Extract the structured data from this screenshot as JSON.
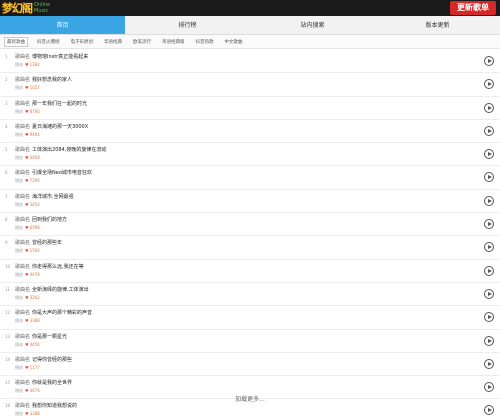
{
  "header": {
    "logo_text": "梦幻阁",
    "logo_sub1": "Online",
    "logo_sub2": "Music",
    "update_label": "更新歌单"
  },
  "nav": {
    "items": [
      "首页",
      "排行榜",
      "站内搜索",
      "版本更新"
    ]
  },
  "subnav": {
    "items": [
      "最新歌曲",
      "抖音火爆榜",
      "电子乐原创",
      "华语经典",
      "欧美流行",
      "英语经典版",
      "抖音热歌",
      "中文歌曲"
    ]
  },
  "list": {
    "prefix": "歌曲名",
    "meta_label": "播放",
    "items": [
      {
        "rank": "1",
        "title": "博物馆Instr真正能看起来",
        "count": "1284"
      },
      {
        "rank": "2",
        "title": "我好想念我的家人",
        "count": "1027"
      },
      {
        "rank": "3",
        "title": "那一年我们在一起的时光",
        "count": "8766"
      },
      {
        "rank": "4",
        "title": "夏日海滩的那一天3000X",
        "count": "9464"
      },
      {
        "rank": "5",
        "title": "工体演出2084,夜晚的旋律在流动",
        "count": "4468"
      },
      {
        "rank": "6",
        "title": "引爆全场Neo城市电音狂欢",
        "count": "7290"
      },
      {
        "rank": "7",
        "title": "海洋城市,全网最强",
        "count": "3456"
      },
      {
        "rank": "8",
        "title": "回到我们的地方",
        "count": "6598"
      },
      {
        "rank": "9",
        "title": "曾经的那些年",
        "count": "1566"
      },
      {
        "rank": "10",
        "title": "你走得那么远,我还在等",
        "count": "4478"
      },
      {
        "rank": "11",
        "title": "全新演绎的旋律,工体演出",
        "count": "3342"
      },
      {
        "rank": "12",
        "title": "你是大声的那个精彩的声音",
        "count": "3388"
      },
      {
        "rank": "13",
        "title": "你是那一颗星光",
        "count": "4456"
      },
      {
        "rank": "14",
        "title": "记得你曾经的那些",
        "count": "1177"
      },
      {
        "rank": "15",
        "title": "你就是我的全世界",
        "count": "4476"
      },
      {
        "rank": "16",
        "title": "我想你知道我想说的",
        "count": "3388"
      }
    ]
  },
  "load_more": "加载更多..."
}
